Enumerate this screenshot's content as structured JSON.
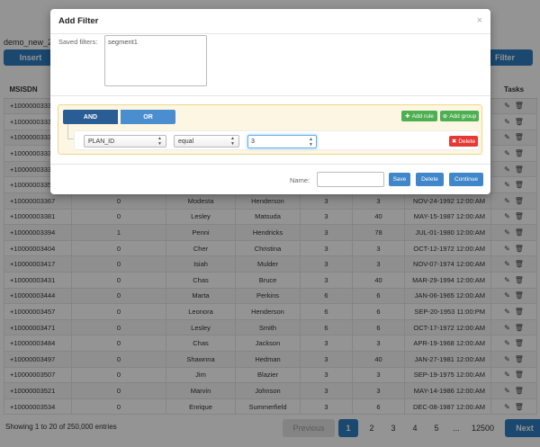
{
  "page": {
    "db_title": "demo_new_2",
    "insert_label": "Insert",
    "filter_label": "Filter"
  },
  "table": {
    "headers": [
      "MSISDN",
      "",
      "",
      "",
      "",
      "",
      "",
      "Tasks"
    ],
    "rows": [
      [
        "+10000003332",
        "",
        "",
        "",
        "",
        "",
        "",
        ""
      ],
      [
        "+10000003335",
        "",
        "",
        "",
        "",
        "",
        "",
        ""
      ],
      [
        "+10000003336",
        "",
        "",
        "",
        "",
        "",
        "",
        ""
      ],
      [
        "+10000003337",
        "",
        "",
        "",
        "",
        "",
        "",
        ""
      ],
      [
        "+10000003339",
        "",
        "",
        "",
        "",
        "",
        "",
        ""
      ],
      [
        "+10000003353",
        "",
        "",
        "",
        "",
        "",
        "",
        ""
      ],
      [
        "+10000003367",
        "0",
        "Modesta",
        "Henderson",
        "3",
        "3",
        "NOV-24-1992 12:00:AM",
        ""
      ],
      [
        "+10000003381",
        "0",
        "Lesley",
        "Matsuda",
        "3",
        "40",
        "MAY-15-1987 12:00:AM",
        ""
      ],
      [
        "+10000003394",
        "1",
        "Penni",
        "Hendricks",
        "3",
        "78",
        "JUL-01-1980 12:00:AM",
        ""
      ],
      [
        "+10000003404",
        "0",
        "Cher",
        "Christina",
        "3",
        "3",
        "OCT-12-1972 12:00:AM",
        ""
      ],
      [
        "+10000003417",
        "0",
        "Isiah",
        "Mulder",
        "3",
        "3",
        "NOV-07-1974 12:00:AM",
        ""
      ],
      [
        "+10000003431",
        "0",
        "Chas",
        "Bruce",
        "3",
        "40",
        "MAR-29-1994 12:00:AM",
        ""
      ],
      [
        "+10000003444",
        "0",
        "Marta",
        "Perkins",
        "6",
        "6",
        "JAN-06-1965 12:00:AM",
        ""
      ],
      [
        "+10000003457",
        "0",
        "Leonora",
        "Henderson",
        "6",
        "6",
        "SEP-20-1953 11:00:PM",
        ""
      ],
      [
        "+10000003471",
        "0",
        "Lesley",
        "Smith",
        "6",
        "6",
        "OCT-17-1972 12:00:AM",
        ""
      ],
      [
        "+10000003484",
        "0",
        "Chas",
        "Jackson",
        "3",
        "3",
        "APR-19-1968 12:00:AM",
        ""
      ],
      [
        "+10000003497",
        "0",
        "Shawnna",
        "Hedman",
        "3",
        "40",
        "JAN-27-1981 12:00:AM",
        ""
      ],
      [
        "+10000003507",
        "0",
        "Jim",
        "Blazier",
        "3",
        "3",
        "SEP-19-1975 12:00:AM",
        ""
      ],
      [
        "+10000003521",
        "0",
        "Marvin",
        "Johnson",
        "3",
        "3",
        "MAY-14-1986 12:00:AM",
        ""
      ],
      [
        "+10000003534",
        "0",
        "Enrique",
        "Summerfield",
        "3",
        "6",
        "DEC-08-1987 12:00:AM",
        ""
      ]
    ]
  },
  "footer": {
    "info": "Showing 1 to 20 of 250,000 entries",
    "previous": "Previous",
    "pages": [
      "1",
      "2",
      "3",
      "4",
      "5"
    ],
    "ellipsis": "...",
    "last_page": "12500",
    "next": "Next",
    "active_page": "1"
  },
  "modal": {
    "title": "Add Filter",
    "close": "×",
    "saved_filters_label": "Saved filters:",
    "saved_filters": [
      "segment1"
    ],
    "and_label": "AND",
    "or_label": "OR",
    "add_rule_label": "Add rule",
    "add_group_label": "Add group",
    "rule": {
      "field": "PLAN_ID",
      "operator": "equal",
      "value": "3",
      "delete_label": "Delete"
    },
    "name_label": "Name:",
    "name_value": "",
    "save_label": "Save",
    "delete_label": "Delete",
    "continue_label": "Continue"
  },
  "colors": {
    "primary": "#2e7dbf",
    "and_active": "#2b5d95",
    "or_inactive": "#4a8ed0",
    "success": "#4caf50",
    "danger": "#e53935",
    "group_bg": "#fcf6e3"
  }
}
